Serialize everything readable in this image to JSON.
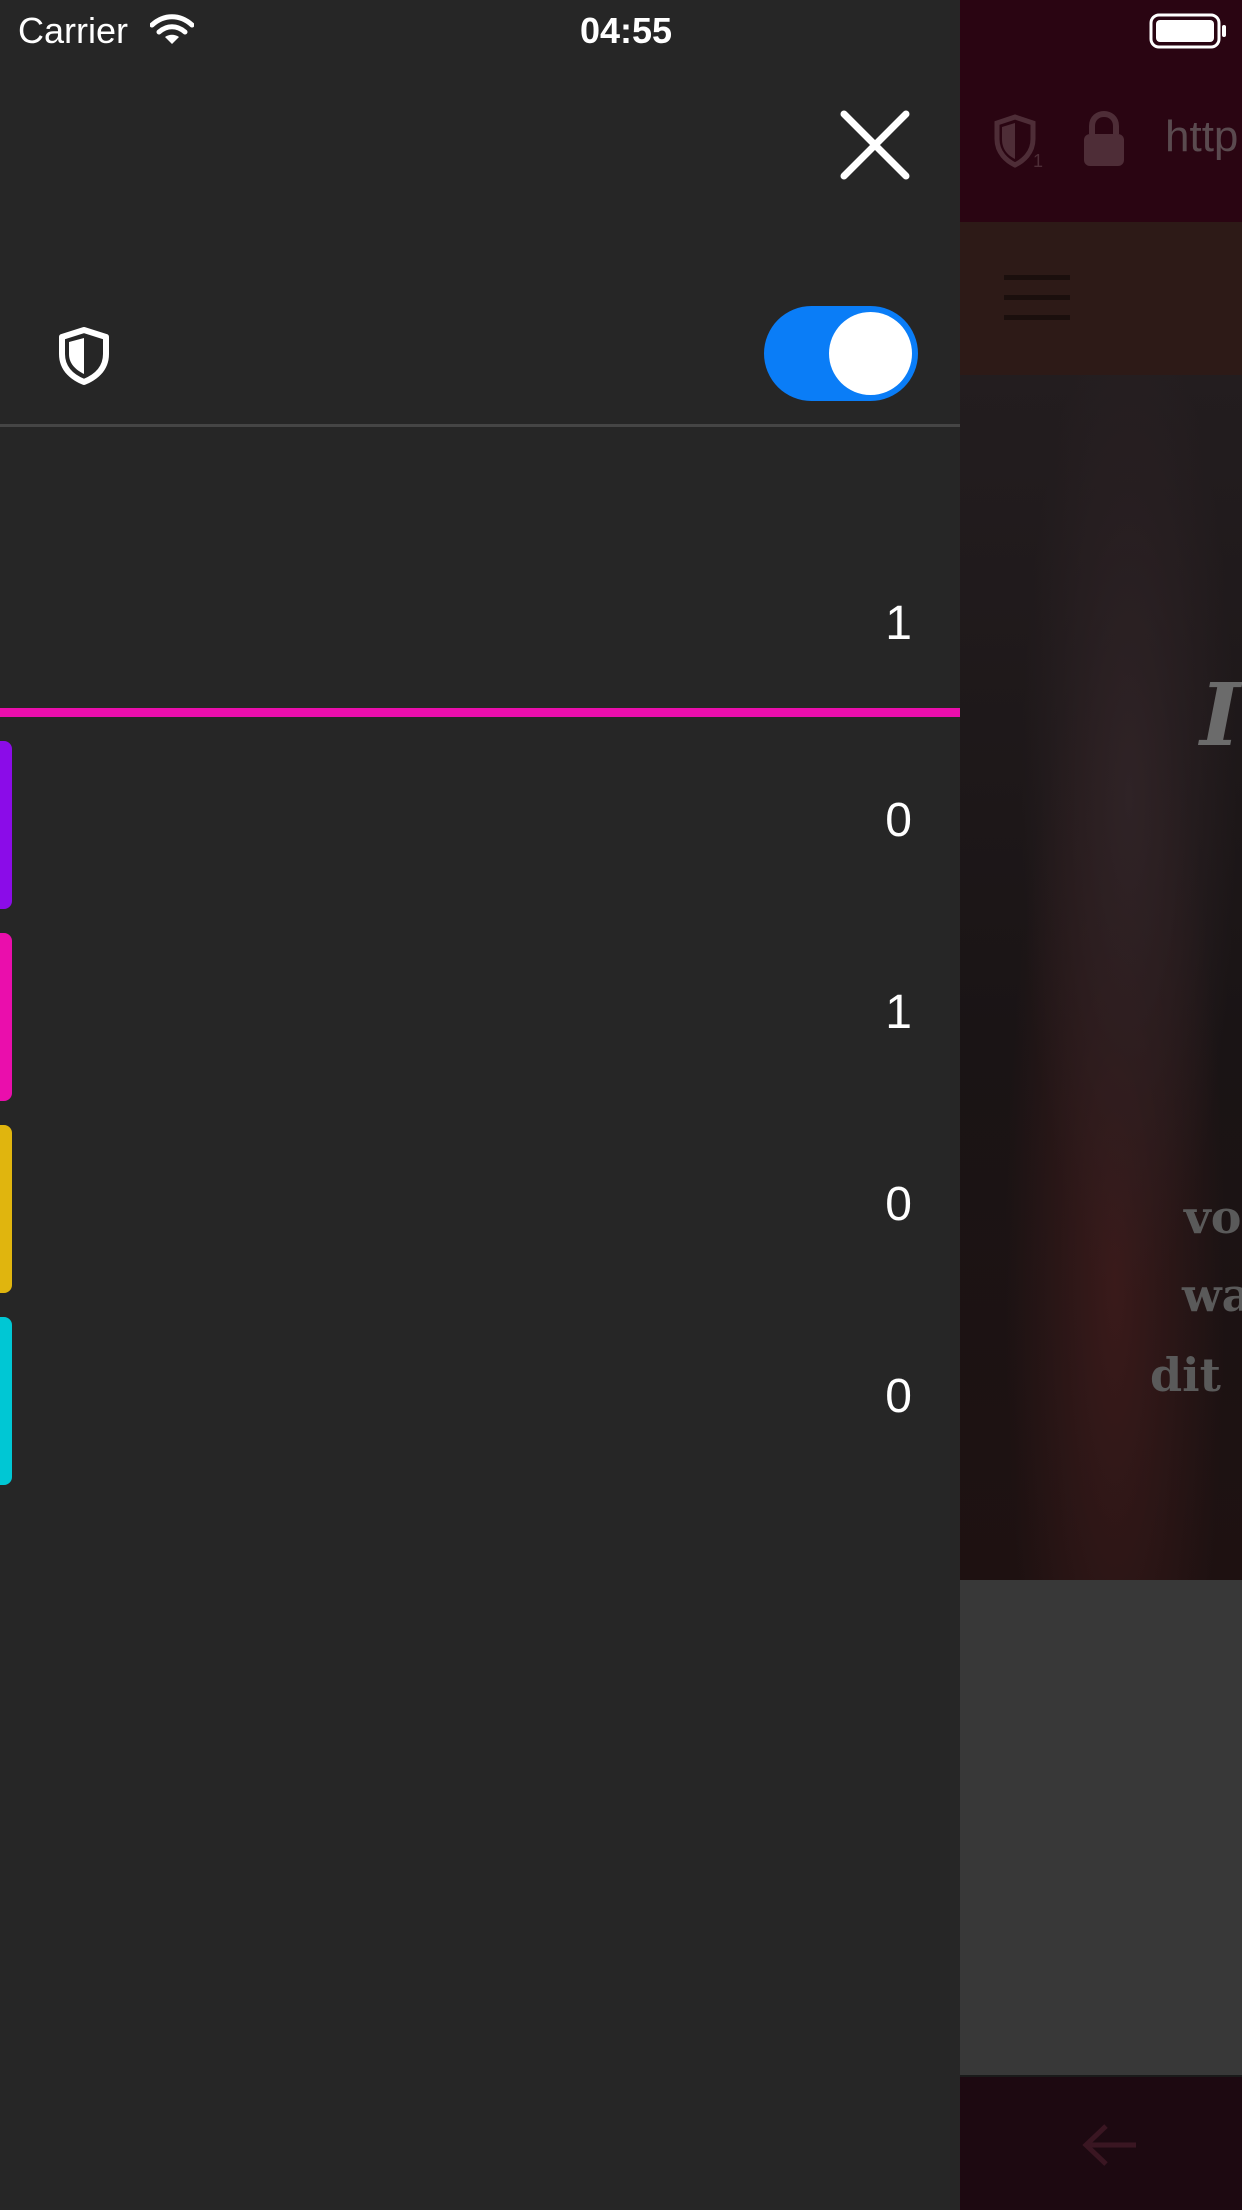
{
  "status_bar": {
    "carrier": "Carrier",
    "time": "04:55",
    "wifi_icon": "wifi-icon",
    "battery_icon": "battery-icon"
  },
  "drawer": {
    "close_icon": "close-icon",
    "shield_icon": "shield-icon",
    "protection_enabled": true,
    "total_count": "1",
    "accent_color": "#ea0eac",
    "toggle_color": "#0a7df7",
    "rows": [
      {
        "count": "0",
        "color": "#8b0ce8"
      },
      {
        "count": "1",
        "color": "#ea0eac"
      },
      {
        "count": "0",
        "color": "#e0b50e"
      },
      {
        "count": "0",
        "color": "#00c7d4"
      }
    ]
  },
  "background_page": {
    "url_partial": "http",
    "shield_badge_count": "1",
    "hero_title_partial": "I",
    "hero_lines_partial": [
      "vo",
      "wa",
      "dit"
    ]
  }
}
